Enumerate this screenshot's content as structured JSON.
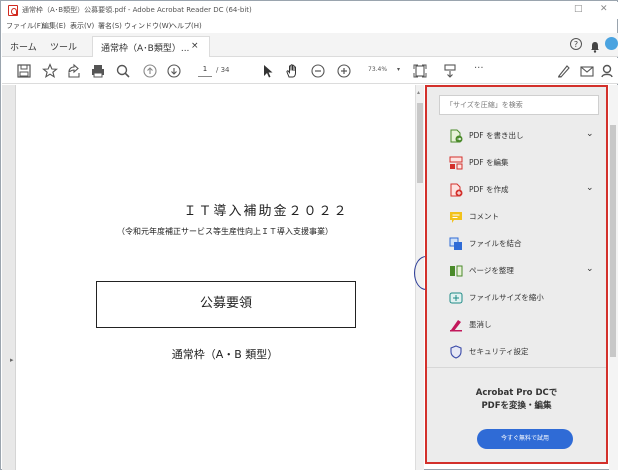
{
  "window": {
    "title": "通常枠（A･B類型）公募要領.pdf - Adobe Acrobat Reader DC (64-bit)",
    "minimize": "□",
    "close": "✕"
  },
  "menu": [
    "ファイル(F)",
    "編集(E)",
    "表示(V)",
    "署名(S)",
    "ウィンドウ(W)",
    "ヘルプ(H)"
  ],
  "tabs": {
    "home": "ホーム",
    "tools": "ツール",
    "document": "通常枠（A･B類型）...",
    "close": "×",
    "help": "?"
  },
  "toolbar": {
    "page_current": "1",
    "page_total": "/ 34",
    "zoom": "73.4%",
    "zoom_caret": "▾",
    "more": "···"
  },
  "document": {
    "heading": "ＩＴ導入補助金２０２２",
    "subheading": "（令和元年度補正サービス等生産性向上ＩＴ導入支援事業）",
    "box_title": "公募要領",
    "frame_label": "通常枠（A・B 類型）"
  },
  "right_pane": {
    "search_placeholder": "「サイズを圧縮」を検索",
    "tools": [
      {
        "label": "PDF を書き出し",
        "icon": "export-pdf-icon",
        "expand": true
      },
      {
        "label": "PDF を編集",
        "icon": "edit-pdf-icon",
        "expand": false
      },
      {
        "label": "PDF を作成",
        "icon": "create-pdf-icon",
        "expand": true
      },
      {
        "label": "コメント",
        "icon": "comment-icon",
        "expand": false
      },
      {
        "label": "ファイルを結合",
        "icon": "combine-files-icon",
        "expand": false
      },
      {
        "label": "ページを整理",
        "icon": "organize-pages-icon",
        "expand": true
      },
      {
        "label": "ファイルサイズを縮小",
        "icon": "compress-pdf-icon",
        "expand": false
      },
      {
        "label": "墨消し",
        "icon": "redact-icon",
        "expand": false
      },
      {
        "label": "セキュリティ設定",
        "icon": "shield-icon",
        "expand": false
      }
    ],
    "promo_line1": "Acrobat Pro DCで",
    "promo_line2": "PDFを変換・編集",
    "promo_button": "今すぐ無料で試用",
    "chevron": "⌄"
  },
  "colors": {
    "highlight_border": "#d3302b",
    "circle_annotation": "#2e3f9a",
    "accent_blue": "#2f6bd6"
  }
}
